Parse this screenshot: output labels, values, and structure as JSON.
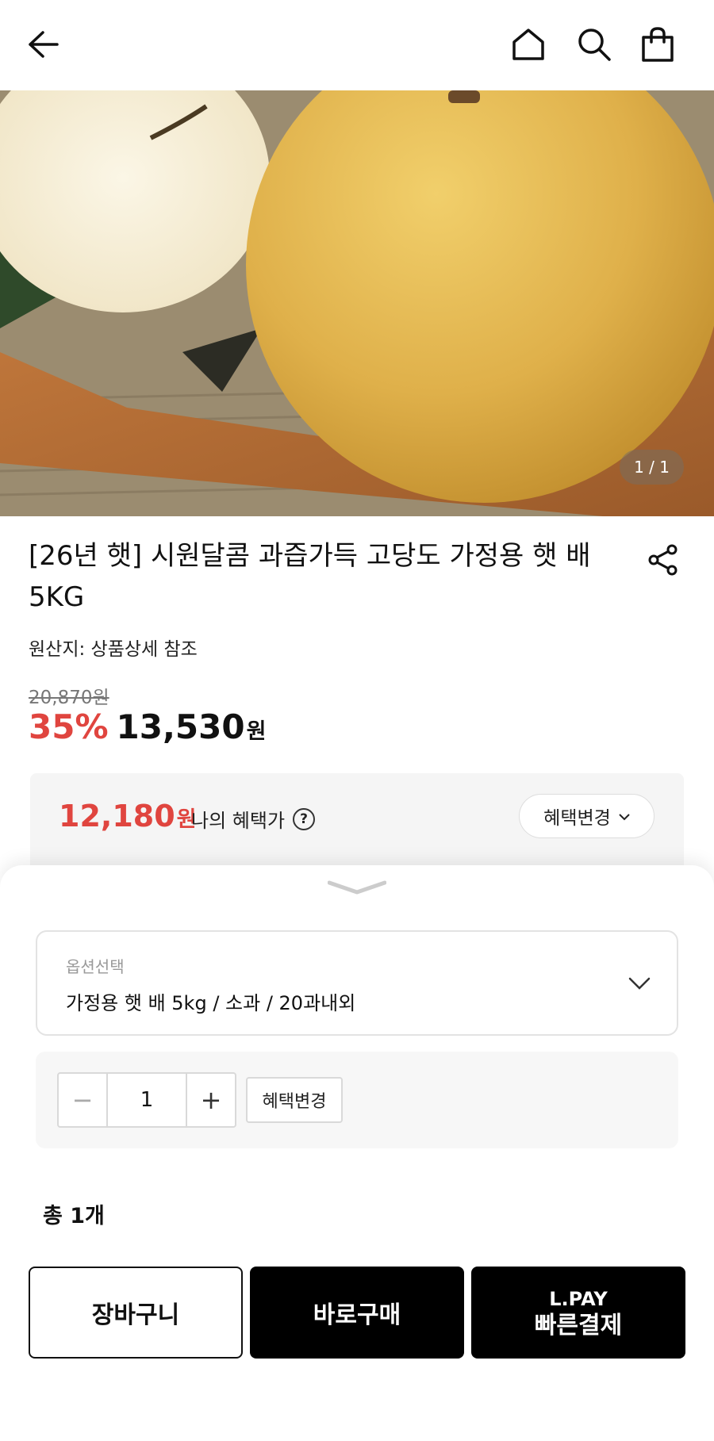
{
  "header": {
    "icons": [
      "back-icon",
      "home-icon",
      "search-icon",
      "bag-icon"
    ]
  },
  "gallery": {
    "counter": "1 / 1"
  },
  "product": {
    "title": "[26년 햇] 시원달콤 과즙가득 고당도 가정용 햇 배 5KG",
    "origin": "원산지: 상품상세 참조",
    "original_price": "20,870원",
    "discount": "35%",
    "price": "13,530",
    "price_unit": "원"
  },
  "benefit": {
    "price": "12,180",
    "price_unit": "원",
    "label": "나의 혜택가",
    "help_icon": "?",
    "change_label": "혜택변경"
  },
  "option": {
    "label": "옵션선택",
    "value": "가정용 햇 배 5kg / 소과 / 20과내외"
  },
  "quantity": {
    "minus": "−",
    "value": "1",
    "plus": "+",
    "benefit_label": "혜택변경"
  },
  "total": "총 1개",
  "actions": {
    "cart": "장바구니",
    "buy": "바로구매",
    "lpay_line1": "L.PAY",
    "lpay_line2": "빠른결제"
  },
  "colors": {
    "accent_red": "#e0453f",
    "button_black": "#000000"
  }
}
